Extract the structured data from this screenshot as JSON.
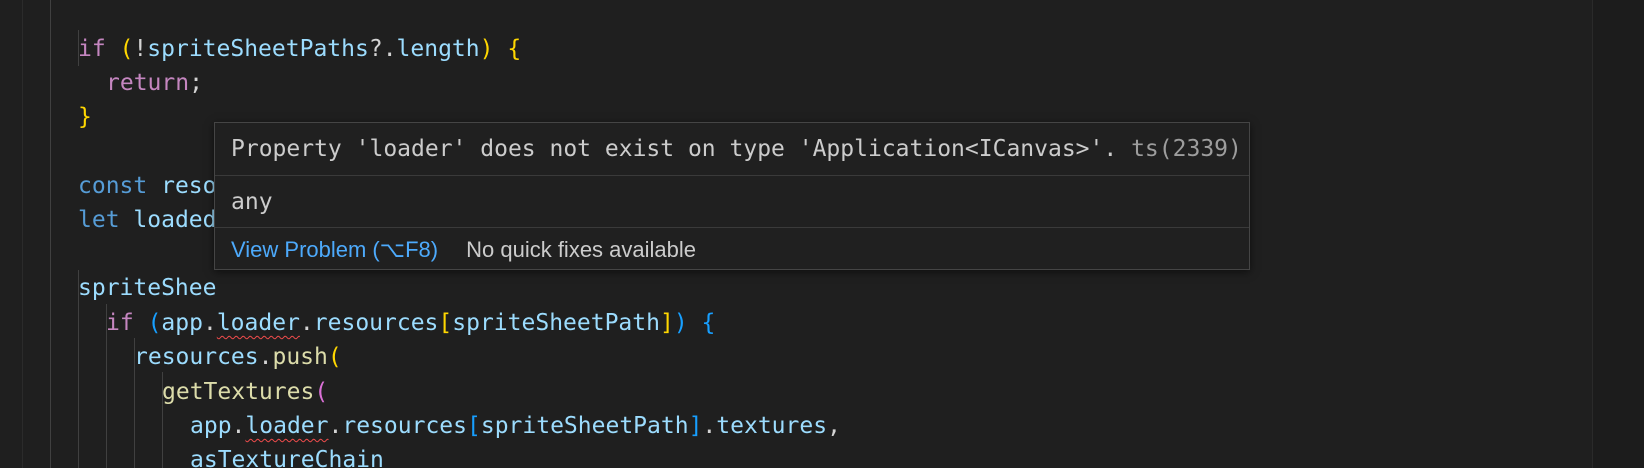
{
  "editor": {
    "line1": {
      "kw_if": "if",
      "open_paren": "(",
      "bang": "!",
      "ident": "spriteSheetPaths",
      "optional": "?.",
      "prop": "length",
      "close_paren": ")",
      "brace": " {"
    },
    "line2": {
      "kw_return": "return",
      "semi": ";"
    },
    "line3": {
      "brace": "}"
    },
    "line5": {
      "kw_const": "const",
      "ident": "reso"
    },
    "line6": {
      "kw_let": "let",
      "ident": "loaded"
    },
    "line8": {
      "ident": "spriteShee"
    },
    "line9": {
      "kw_if": "if",
      "open_paren": "(",
      "app": "app",
      "dot1": ".",
      "loader": "loader",
      "dot2": ".",
      "resources": "resources",
      "open_br": "[",
      "path": "spriteSheetPath",
      "close_br": "]",
      "close_paren": ")",
      "brace": " {"
    },
    "line10": {
      "ident": "resources",
      "dot": ".",
      "fn": "push",
      "paren": "("
    },
    "line11": {
      "fn": "getTextures",
      "paren": "("
    },
    "line12": {
      "app": "app",
      "dot1": ".",
      "loader": "loader",
      "dot2": ".",
      "resources": "resources",
      "open_br": "[",
      "path": "spriteSheetPath",
      "close_br": "]",
      "dot3": ".",
      "textures": "textures",
      "comma": ","
    },
    "line13": {
      "ident": "asTextureChain"
    }
  },
  "hover": {
    "message": "Property 'loader' does not exist on type 'Application<ICanvas>'.",
    "code": "ts(2339)",
    "type_preview": "any",
    "view_problem_label": "View Problem (⌥F8)",
    "no_fixes_label": "No quick fixes available"
  },
  "colors": {
    "background": "#1f1f1f",
    "keyword_control": "#c586c0",
    "keyword": "#569cd6",
    "variable": "#9cdcfe",
    "function": "#dcdcaa",
    "error_squiggle": "#f14c4c",
    "link": "#4daafc"
  }
}
